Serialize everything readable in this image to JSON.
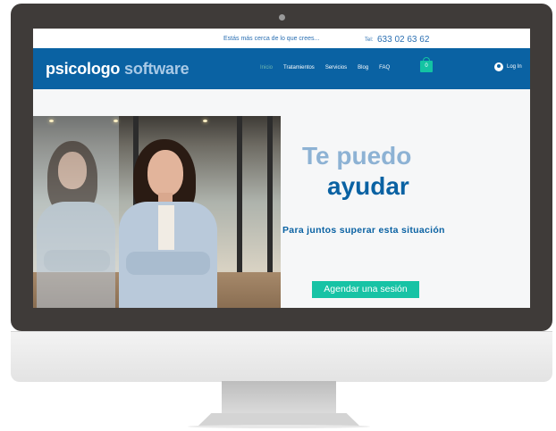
{
  "topbar": {
    "promo_text": "Estás más cerca de lo que crees...",
    "tel_label": "Tel:",
    "tel_number": "633 02 63 62"
  },
  "navbar": {
    "logo_part1": "psicologo",
    "logo_part2": "software",
    "menu": [
      "Inicio",
      "Tratamientos",
      "Servicios",
      "Blog",
      "FAQ"
    ],
    "active_item": "Inicio",
    "cart_count": "0",
    "login_label": "Log In"
  },
  "hero": {
    "title_line1": "Te puedo",
    "title_line2": "ayudar",
    "subtitle": "Para juntos superar esta situación",
    "cta_label": "Agendar una sesión"
  },
  "icons": {
    "cart": "shopping-bag-icon",
    "login": "user-icon"
  },
  "colors": {
    "brand_blue": "#0a62a3",
    "accent_teal": "#17c3a5",
    "light_blue": "#8db2d4",
    "bezel": "#3f3b39"
  }
}
